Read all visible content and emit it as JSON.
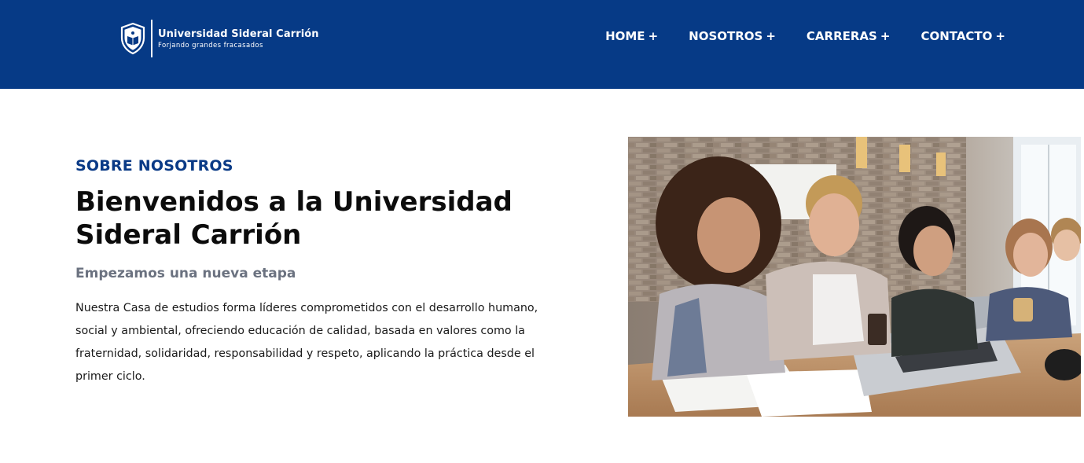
{
  "brand": {
    "name": "Universidad Sideral Carrión",
    "tagline": "Forjando grandes fracasados"
  },
  "nav": {
    "items": [
      {
        "label": "HOME",
        "suffix": "+"
      },
      {
        "label": "NOSOTROS",
        "suffix": "+"
      },
      {
        "label": "CARRERAS",
        "suffix": "+"
      },
      {
        "label": "CONTACTO",
        "suffix": "+"
      }
    ]
  },
  "about": {
    "eyebrow": "SOBRE NOSOTROS",
    "title": "Bienvenidos a la Universidad Sideral Carrión",
    "subtitle": "Empezamos una nueva etapa",
    "description": "Nuestra Casa de estudios forma líderes comprometidos con el desarrollo humano, social y ambiental, ofreciendo educación de calidad, basada en valores como la fraternidad, solidaridad, responsabilidad y respeto, aplicando la práctica desde el primer ciclo."
  },
  "colors": {
    "header_bg": "#063a86",
    "accent": "#0a3a86",
    "muted": "#6b7280"
  },
  "icons": {
    "logo": "university-shield-icon"
  }
}
